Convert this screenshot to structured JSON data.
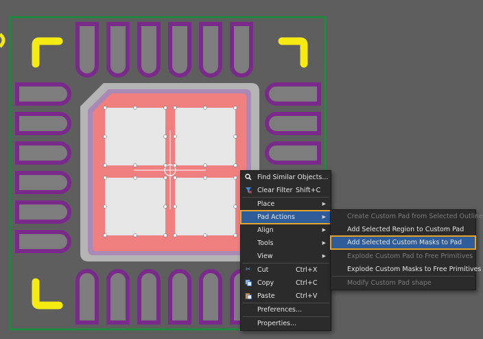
{
  "colors": {
    "board_bg": "#5e5e5e",
    "board_outline": "#1f8a3c",
    "pad_purple": "#7a2a8a",
    "pad_gray": "#7d7d7d",
    "silk_yellow": "#f5ea12",
    "mask_pink": "#f08080",
    "paste_white": "#e6e6e6",
    "menu_bg": "#2b2b2b",
    "menu_highlight": "#2f5d9a",
    "callout_orange": "#e6a52a"
  },
  "context_menu": {
    "items": [
      {
        "label": "Find Similar Objects...",
        "shortcut": "",
        "icon": "search-icon",
        "submenu": false,
        "disabled": false
      },
      {
        "label": "Clear Filter",
        "shortcut": "Shift+C",
        "icon": "filter-clear-icon",
        "submenu": false,
        "disabled": false
      },
      {
        "label": "Place",
        "shortcut": "",
        "icon": "",
        "submenu": true,
        "disabled": false
      },
      {
        "label": "Pad Actions",
        "shortcut": "",
        "icon": "",
        "submenu": true,
        "disabled": false,
        "highlighted": true
      },
      {
        "label": "Align",
        "shortcut": "",
        "icon": "",
        "submenu": true,
        "disabled": false
      },
      {
        "label": "Tools",
        "shortcut": "",
        "icon": "",
        "submenu": true,
        "disabled": false
      },
      {
        "label": "View",
        "shortcut": "",
        "icon": "",
        "submenu": true,
        "disabled": false
      },
      {
        "label": "Cut",
        "shortcut": "Ctrl+X",
        "icon": "scissors-icon",
        "submenu": false,
        "disabled": false
      },
      {
        "label": "Copy",
        "shortcut": "Ctrl+C",
        "icon": "copy-icon",
        "submenu": false,
        "disabled": false
      },
      {
        "label": "Paste",
        "shortcut": "Ctrl+V",
        "icon": "paste-icon",
        "submenu": false,
        "disabled": false
      },
      {
        "label": "Preferences...",
        "shortcut": "",
        "icon": "",
        "submenu": false,
        "disabled": false
      },
      {
        "label": "Properties...",
        "shortcut": "",
        "icon": "",
        "submenu": false,
        "disabled": false
      }
    ]
  },
  "pad_actions_submenu": {
    "items": [
      {
        "label": "Create Custom Pad from Selected Outline",
        "disabled": true
      },
      {
        "label": "Add Selected Region to Custom Pad",
        "disabled": false
      },
      {
        "label": "Add Selected Custom Masks to Pad",
        "disabled": false,
        "highlighted": true
      },
      {
        "label": "Explode Custom Pad to Free Primitives",
        "disabled": true
      },
      {
        "label": "Explode Custom Masks to Free Primitives",
        "disabled": false
      },
      {
        "label": "Modify Custom Pad shape",
        "disabled": true
      }
    ]
  }
}
